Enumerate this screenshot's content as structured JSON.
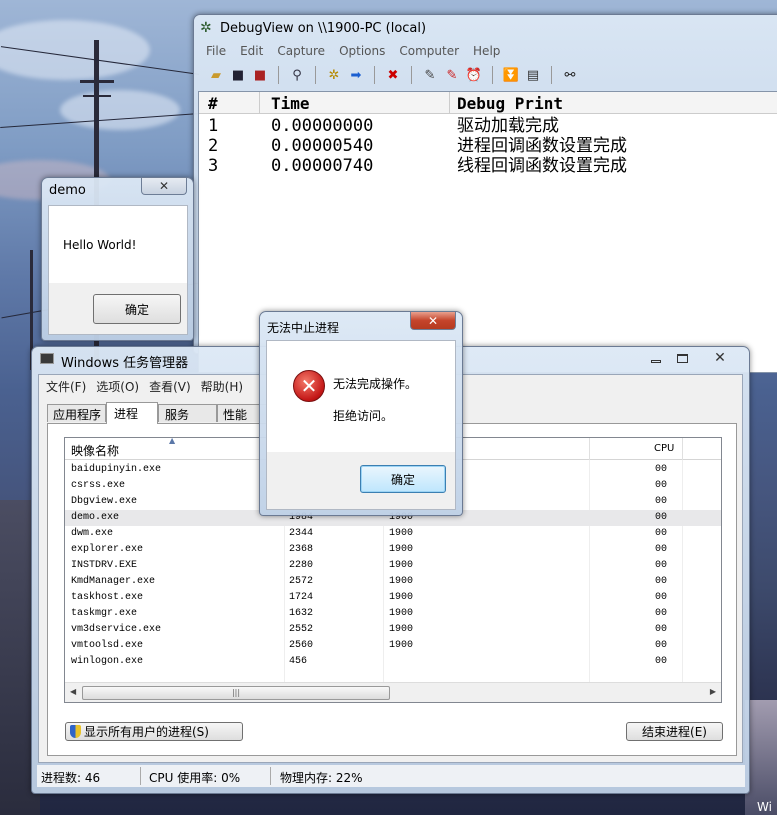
{
  "debugview": {
    "title": "DebugView on \\\\1900-PC (local)",
    "menu": [
      "File",
      "Edit",
      "Capture",
      "Options",
      "Computer",
      "Help"
    ],
    "columns": {
      "num": "#",
      "time": "Time",
      "print": "Debug Print"
    },
    "rows": [
      {
        "num": "1",
        "time": "0.00000000",
        "print": "驱动加载完成"
      },
      {
        "num": "2",
        "time": "0.00000540",
        "print": "进程回调函数设置完成"
      },
      {
        "num": "3",
        "time": "0.00000740",
        "print": "线程回调函数设置完成"
      }
    ]
  },
  "demo": {
    "title": "demo",
    "message": "Hello World!",
    "ok": "确定",
    "close": "✕"
  },
  "error_dialog": {
    "title": "无法中止进程",
    "line1": "无法完成操作。",
    "line2": "拒绝访问。",
    "ok": "确定",
    "close": "✕"
  },
  "taskmgr": {
    "title": "Windows 任务管理器",
    "menu": [
      "文件(F)",
      "选项(O)",
      "查看(V)",
      "帮助(H)"
    ],
    "tabs": [
      "应用程序",
      "进程",
      "服务",
      "性能"
    ],
    "columns": {
      "name": "映像名称",
      "cpu": "CPU"
    },
    "processes": [
      {
        "name": "baidupinyin.exe",
        "pid": "",
        "user": "",
        "cpu": "00"
      },
      {
        "name": "csrss.exe",
        "pid": "",
        "user": "",
        "cpu": "00"
      },
      {
        "name": "Dbgview.exe",
        "pid": "",
        "user": "",
        "cpu": "00"
      },
      {
        "name": "demo.exe",
        "pid": "1984",
        "user": "1900",
        "cpu": "00"
      },
      {
        "name": "dwm.exe",
        "pid": "2344",
        "user": "1900",
        "cpu": "00"
      },
      {
        "name": "explorer.exe",
        "pid": "2368",
        "user": "1900",
        "cpu": "00"
      },
      {
        "name": "INSTDRV.EXE",
        "pid": "2280",
        "user": "1900",
        "cpu": "00"
      },
      {
        "name": "KmdManager.exe",
        "pid": "2572",
        "user": "1900",
        "cpu": "00"
      },
      {
        "name": "taskhost.exe",
        "pid": "1724",
        "user": "1900",
        "cpu": "00"
      },
      {
        "name": "taskmgr.exe",
        "pid": "1632",
        "user": "1900",
        "cpu": "00"
      },
      {
        "name": "vm3dservice.exe",
        "pid": "2552",
        "user": "1900",
        "cpu": "00"
      },
      {
        "name": "vmtoolsd.exe",
        "pid": "2560",
        "user": "1900",
        "cpu": "00"
      },
      {
        "name": "winlogon.exe",
        "pid": "456",
        "user": "",
        "cpu": "00"
      }
    ],
    "show_all_button": "显示所有用户的进程(S)",
    "end_process_button": "结束进程(E)",
    "status": {
      "processes": "进程数: 46",
      "cpu": "CPU 使用率: 0%",
      "memory": "物理内存: 22%"
    }
  },
  "desktop": {
    "edge_text": "Wi"
  }
}
